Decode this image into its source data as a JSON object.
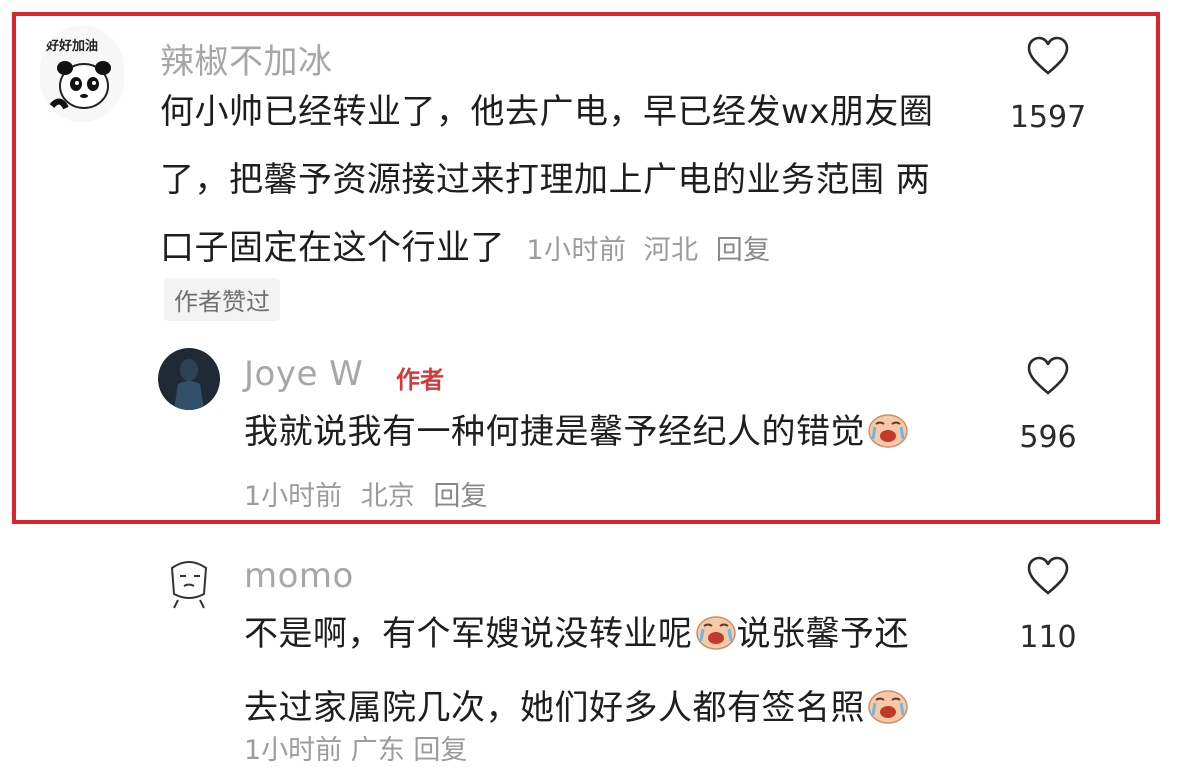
{
  "comment1": {
    "username": "辣椒不加冰",
    "text": "何小帅已经转业了，他去广电，早已经发wx朋友圈了，把馨予资源接过来打理加上广电的业务范围 两口子固定在这个行业了",
    "time": "1小时前",
    "location": "河北",
    "reply_label": "回复",
    "likes": "1597",
    "author_liked": "作者赞过",
    "avatar_text": "好好加油"
  },
  "reply1": {
    "username": "Joye W",
    "author_tag": "作者",
    "text": "我就说我有一种何捷是馨予经纪人的错觉",
    "time": "1小时前",
    "location": "北京",
    "reply_label": "回复",
    "likes": "596"
  },
  "comment2": {
    "username": "momo",
    "text_line1": "不是啊，有个军嫂说没转业呢",
    "text_line2": "说张馨予还",
    "text_line3": "去过家属院几次，她们好多人都有签名照",
    "likes": "110",
    "partial_meta": "1小时前 广东 回复"
  },
  "icons": {
    "heart": "heart-outline-icon",
    "emoji": "crying-face-emoji"
  },
  "colors": {
    "highlight": "#d8262f",
    "author_tag": "#d23a3a"
  }
}
